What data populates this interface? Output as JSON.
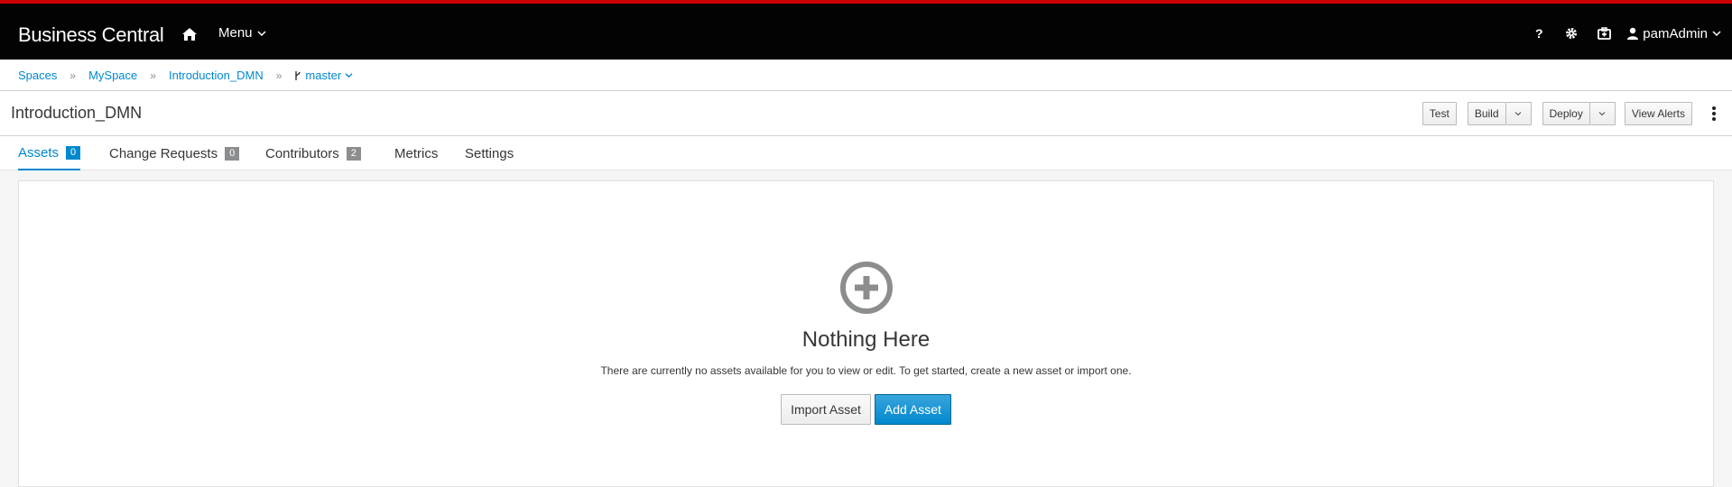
{
  "app": {
    "title": "Business Central"
  },
  "nav": {
    "menu_label": "Menu",
    "help_icon": "question-icon",
    "settings_icon": "gear-icon",
    "apps_icon": "case-icon",
    "user_label": "pamAdmin"
  },
  "breadcrumb": {
    "items": [
      "Spaces",
      "MySpace",
      "Introduction_DMN"
    ],
    "branch": "master"
  },
  "project": {
    "title": "Introduction_DMN"
  },
  "toolbar": {
    "test": "Test",
    "build": "Build",
    "deploy": "Deploy",
    "view_alerts": "View Alerts"
  },
  "tabs": [
    {
      "label": "Assets",
      "count": "0"
    },
    {
      "label": "Change Requests",
      "count": "0"
    },
    {
      "label": "Contributors",
      "count": "2"
    },
    {
      "label": "Metrics"
    },
    {
      "label": "Settings"
    }
  ],
  "empty_state": {
    "title": "Nothing Here",
    "text": "There are currently no assets available for you to view or edit. To get started, create a new asset or import one.",
    "import_label": "Import Asset",
    "add_label": "Add Asset"
  },
  "colors": {
    "accent": "#0088ce",
    "topbar": "#030303",
    "topbar_stripe": "#cc0000"
  }
}
